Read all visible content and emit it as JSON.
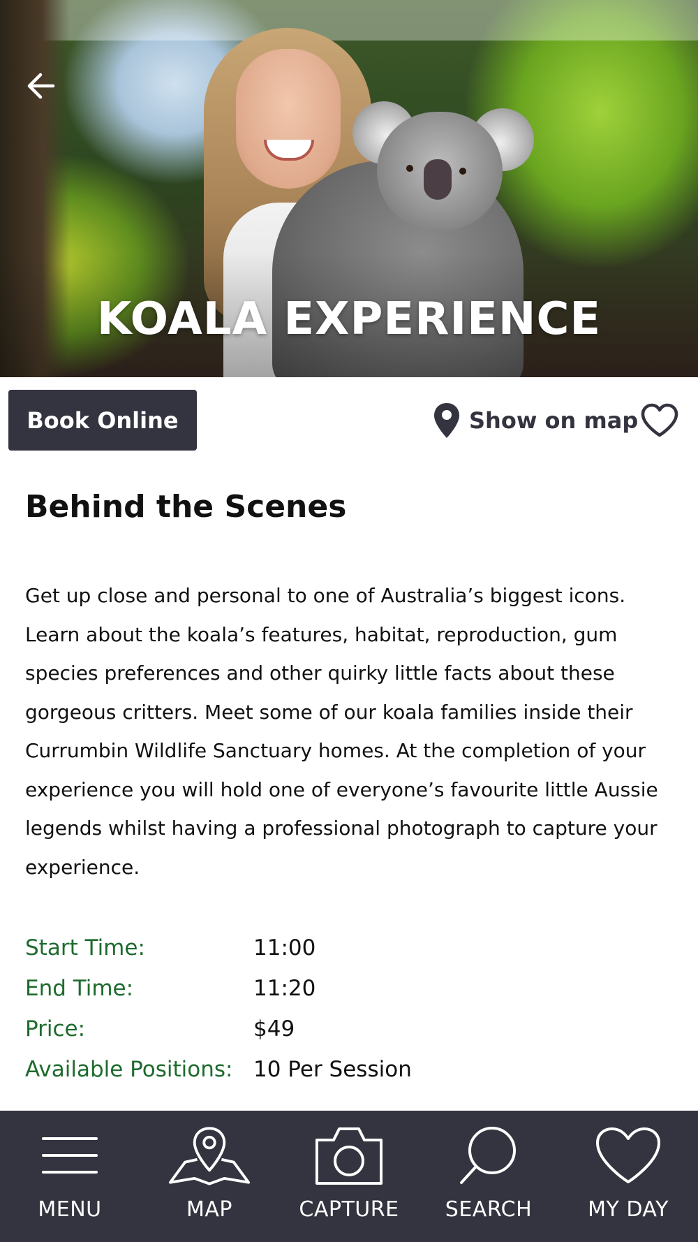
{
  "hero": {
    "title": "KOALA EXPERIENCE"
  },
  "actions": {
    "book_label": "Book Online",
    "map_label": "Show on map"
  },
  "content": {
    "section_title": "Behind the Scenes",
    "description": "Get up close and personal to one of Australia’s biggest icons. Learn about the koala’s features, habitat, reproduction, gum species preferences and other quirky little facts about these gorgeous critters. Meet some of our koala families inside their Currumbin Wildlife Sanctuary homes. At the completion of your experience you will hold one of everyone’s favourite little Aussie legends whilst having a professional photograph to capture your experience."
  },
  "details": [
    {
      "label": "Start Time:",
      "value": "11:00"
    },
    {
      "label": "End Time:",
      "value": "11:20"
    },
    {
      "label": "Price:",
      "value": "$49"
    },
    {
      "label": "Available Positions:",
      "value": "10 Per Session"
    }
  ],
  "nav": {
    "items": [
      {
        "label": "MENU",
        "icon": "menu-icon"
      },
      {
        "label": "MAP",
        "icon": "map-icon"
      },
      {
        "label": "CAPTURE",
        "icon": "camera-icon"
      },
      {
        "label": "SEARCH",
        "icon": "search-icon"
      },
      {
        "label": "MY DAY",
        "icon": "heart-icon"
      }
    ]
  },
  "colors": {
    "nav_background": "#343440",
    "button_background": "#343440",
    "detail_label": "#1e6b2e",
    "text": "#111111"
  }
}
